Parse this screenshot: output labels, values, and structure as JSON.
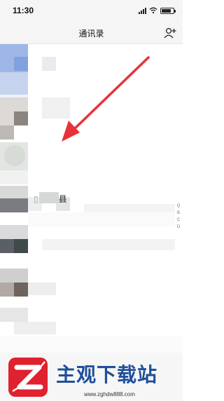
{
  "status_bar": {
    "time": "11:30"
  },
  "nav": {
    "title": "通讯录",
    "add_icon": "add-contact-icon"
  },
  "list": {
    "highlighted_contact_suffix": "县"
  },
  "index_bar": {
    "letters": [
      "Q",
      "B",
      "C",
      "D"
    ]
  },
  "annotation": {
    "arrow_color": "#e8323a"
  },
  "watermark": {
    "brand": "主观下载站",
    "url": "www.zghdw888.com",
    "logo_color": "#e0212e",
    "brand_color": "#1f4f9b"
  }
}
